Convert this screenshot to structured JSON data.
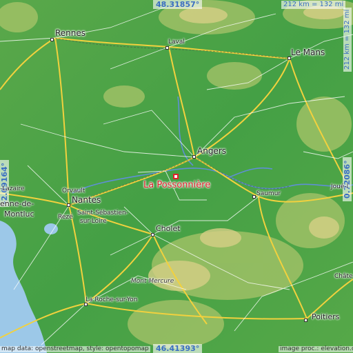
{
  "title_coords": {
    "north": "48.31857°",
    "south": "46.41393°",
    "west": "-2.09164°",
    "east": "0.72086°"
  },
  "scale": {
    "horizontal": "212 km = 132 mi",
    "vertical": "212 km = 132 mi"
  },
  "highlight": {
    "name": "La Possonnière"
  },
  "places": {
    "rennes": "Rennes",
    "laval": "Laval",
    "le_mans": "Le Mans",
    "angers": "Angers",
    "saumur": "Saumur",
    "joue": "Joué-l",
    "orvault": "Orvault",
    "nantes": "Nantes",
    "lazaire": "-Lazaire",
    "montluc_1": "enne-de-",
    "montluc_2": "Montluc",
    "reze": "Rezé",
    "st_sebastien_1": "Saint-Sébastien-",
    "st_sebastien_2": "sur-Loire",
    "cholet": "Cholet",
    "mont_mercure": "Mont Mercure",
    "la_roche": "La Roche-sur-Yon",
    "poitiers": "Poitiers",
    "chate": "Châte"
  },
  "credits": {
    "left": "map data: openstreetmap, style: opentopomap",
    "right": "image proc.: elevation.city"
  },
  "colors": {
    "sea": "#9cc8e8",
    "lowland": "#3f9e45",
    "upland": "#c9cf7a",
    "highlight": "#e0202a",
    "coord_text": "#3a6ec2"
  }
}
